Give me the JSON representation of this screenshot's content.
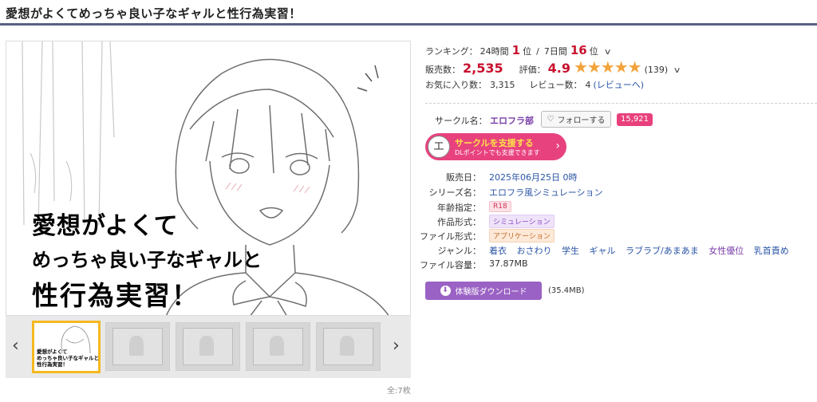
{
  "title": "愛想がよくてめっちゃ良い子なギャルと性行為実習！",
  "main_image": {
    "line1": "愛想がよくて",
    "line2": "めっちゃ良い子なギャルと",
    "line3": "性行為実習！"
  },
  "thumbnails": {
    "prev": "‹",
    "next": "›",
    "counter": "全:7枚",
    "first_mini": [
      "愛想がよくて",
      "めっちゃ良い子なギャルと",
      "性行為実習！"
    ]
  },
  "ranking": {
    "label": "ランキング：",
    "d24_label": "24時間",
    "d24_value": "1",
    "d24_unit": "位",
    "slash": "/",
    "d7_label": "7日間",
    "d7_value": "16",
    "d7_unit": "位"
  },
  "sales": {
    "label": "販売数：",
    "value": "2,535",
    "rating_label": "評価：",
    "rating_value": "4.9",
    "stars": "★★★★★",
    "rating_count": "(139)"
  },
  "favorites": {
    "label": "お気に入り数：",
    "value": "3,315",
    "review_label": "レビュー数：",
    "review_value": "4",
    "review_link": "(レビューへ)"
  },
  "circle": {
    "label": "サークル名：",
    "name": "エロフラ部",
    "follow_label": "フォローする",
    "follow_count": "15,921"
  },
  "support": {
    "icon_text": "エ",
    "main": "サークルを支援する",
    "sub": "DLポイントでも支援できます",
    "arrow": "›"
  },
  "specs": {
    "release_label": "販売日：",
    "release_value": "2025年06月25日 0時",
    "series_label": "シリーズ名：",
    "series_value": "エロフラ風シミュレーション",
    "age_label": "年齢指定：",
    "age_value": "R18",
    "format_label": "作品形式：",
    "format_value": "シミュレーション",
    "file_format_label": "ファイル形式：",
    "file_format_value": "アプリケーション",
    "genre_label": "ジャンル：",
    "genres": [
      "着衣",
      "おさわり",
      "学生",
      "ギャル",
      "ラブラブ/あまあま",
      "女性優位",
      "乳首責め"
    ],
    "size_label": "ファイル容量：",
    "size_value": "37.87MB"
  },
  "download": {
    "label": "体験版ダウンロード",
    "size": "(35.4MB)"
  },
  "colors": {
    "accent_red": "#c8102e",
    "pink": "#e8427e",
    "purple": "#9a62c4",
    "link_blue": "#2a55a6",
    "star": "#f2a33a",
    "title_rule": "#5a6185"
  }
}
